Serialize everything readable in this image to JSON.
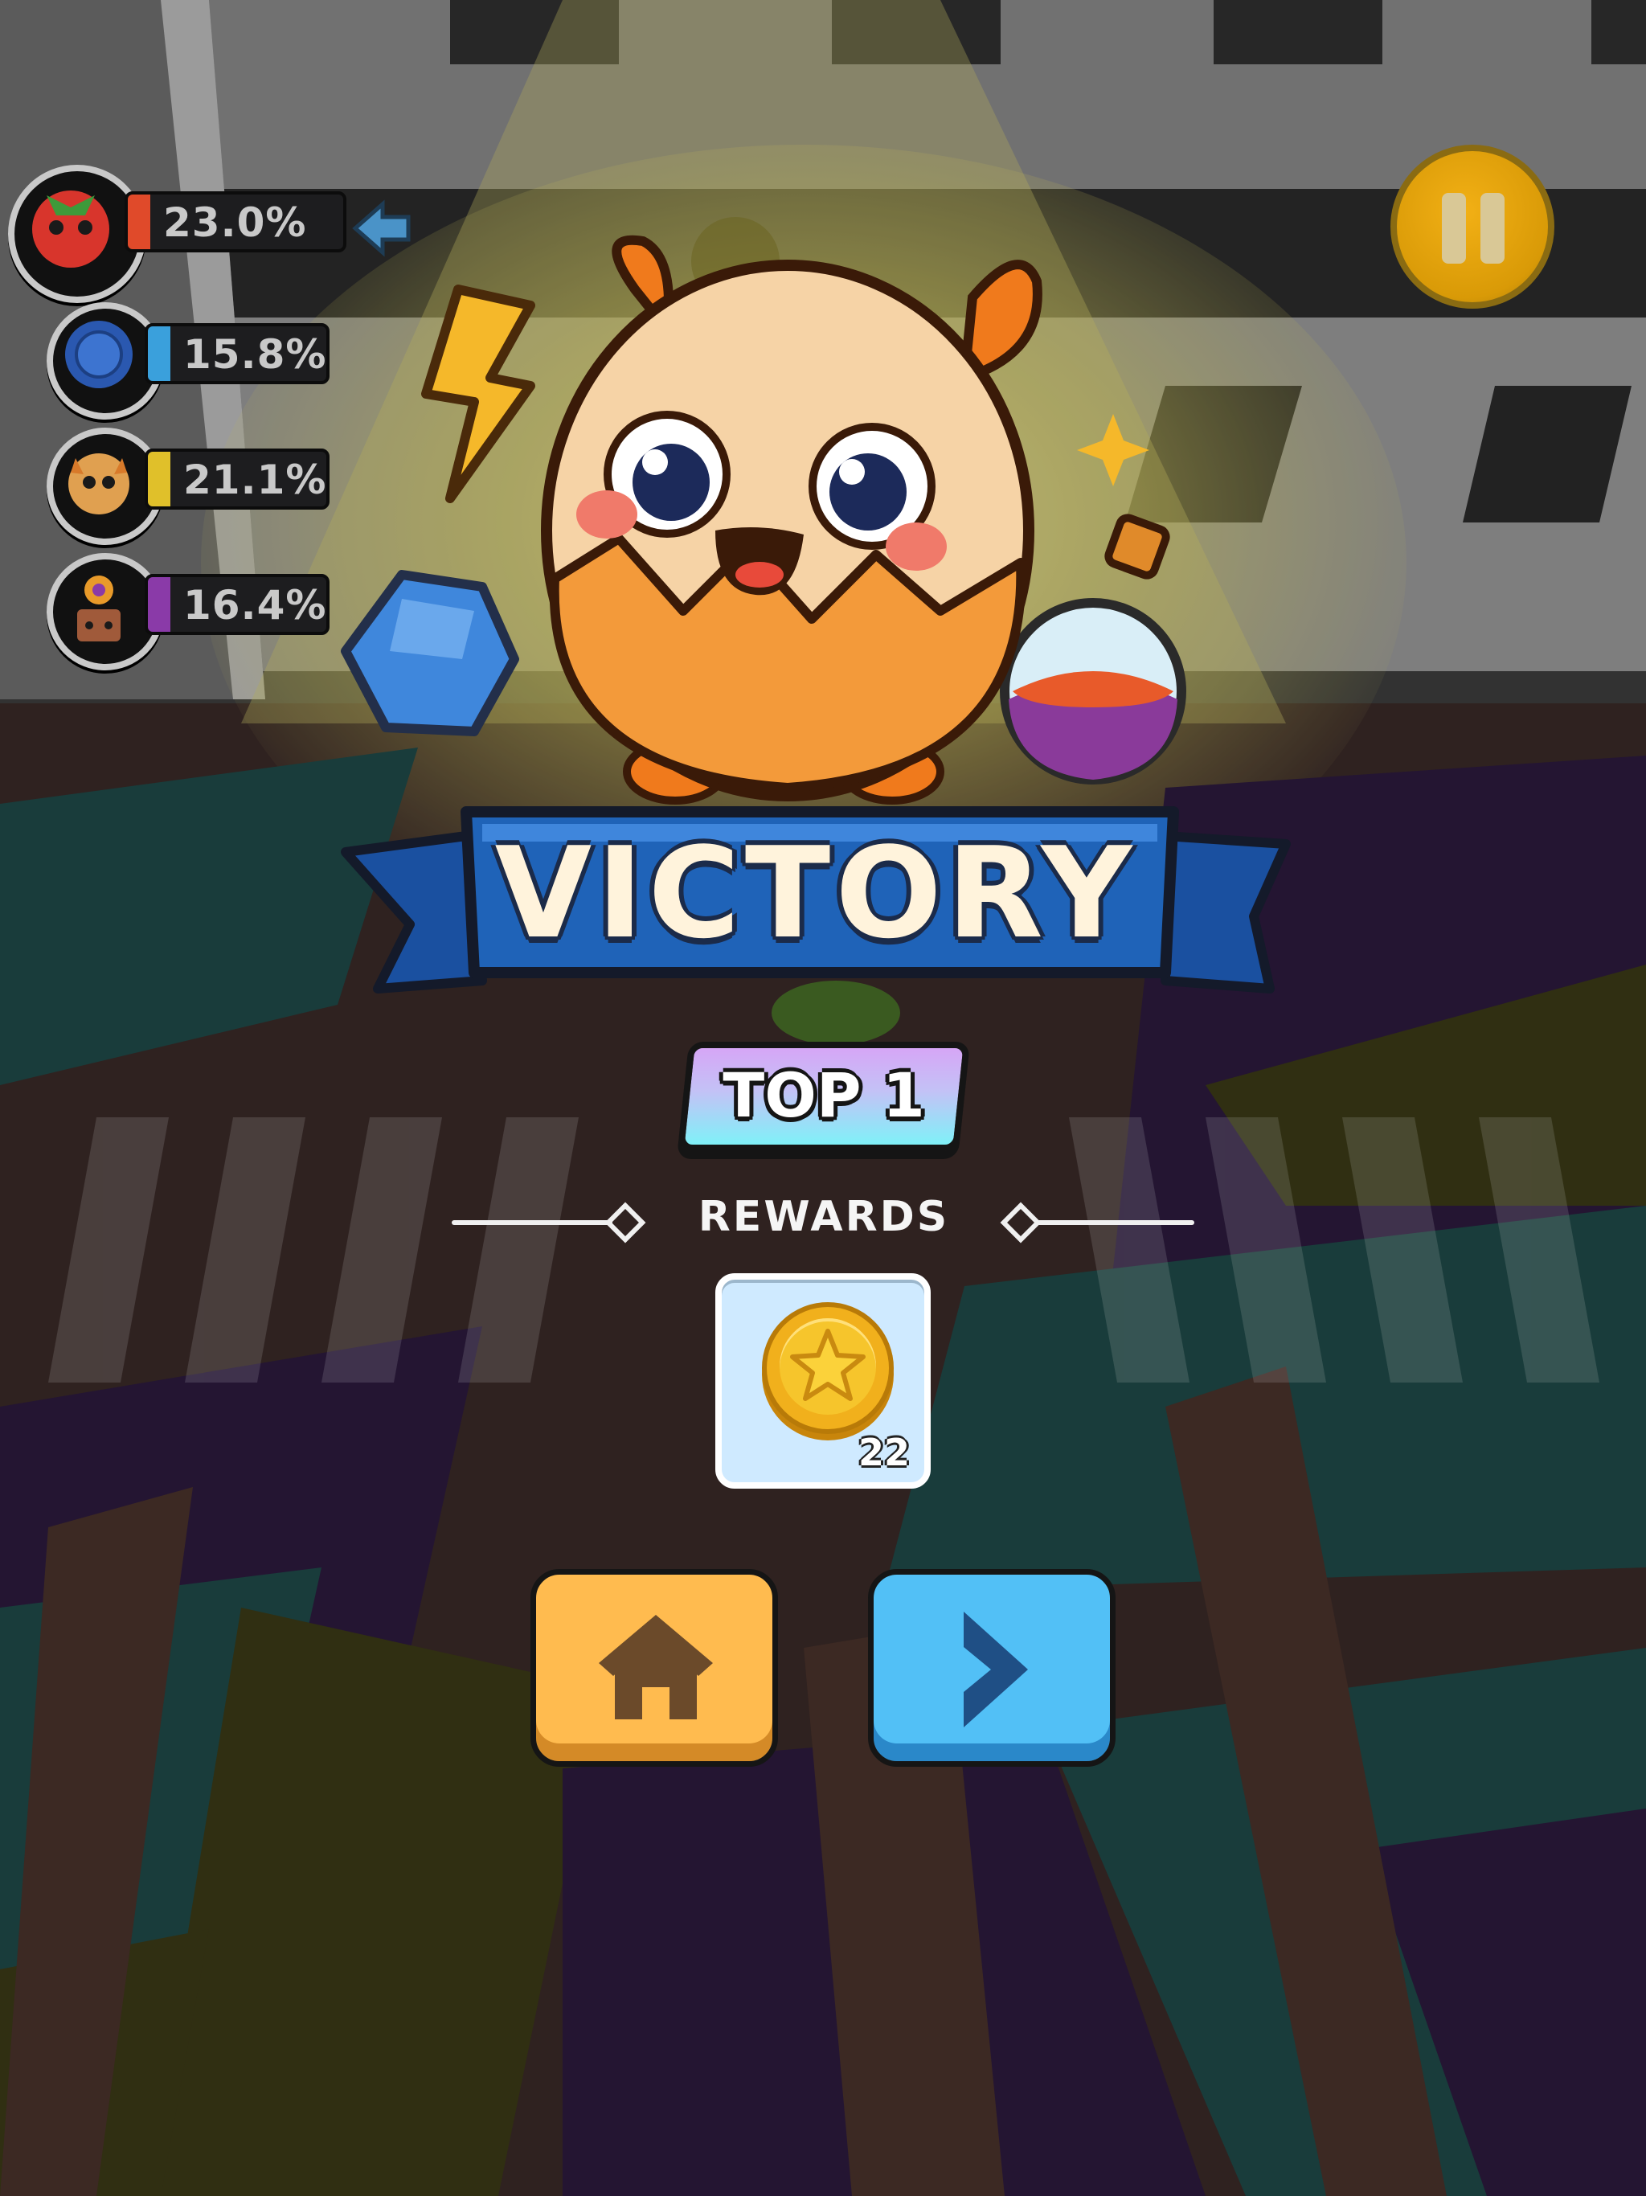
{
  "scoreboard": {
    "players": [
      {
        "name": "strawberry",
        "percent": "23.0%",
        "color": "#e04a2a",
        "highlight": true
      },
      {
        "name": "blue-globe",
        "percent": "15.8%",
        "color": "#3aa0dc",
        "highlight": false
      },
      {
        "name": "horned-blob",
        "percent": "21.1%",
        "color": "#e0c02a",
        "highlight": false
      },
      {
        "name": "flower-pot",
        "percent": "16.4%",
        "color": "#8a3aa8",
        "highlight": false
      }
    ]
  },
  "result": {
    "title": "VICTORY",
    "rank_label": "TOP 1"
  },
  "rewards": {
    "header": "REWARDS",
    "items": [
      {
        "icon": "star-coin-icon",
        "quantity": "22"
      }
    ]
  },
  "actions": {
    "home": {
      "icon": "home-icon"
    },
    "next": {
      "icon": "chevron-right-icon"
    }
  },
  "colors": {
    "ribbon_blue": "#1f63b8",
    "home_button": "#ffbb4f",
    "next_button": "#52c0f6",
    "pause_button": "#e8a40f"
  }
}
